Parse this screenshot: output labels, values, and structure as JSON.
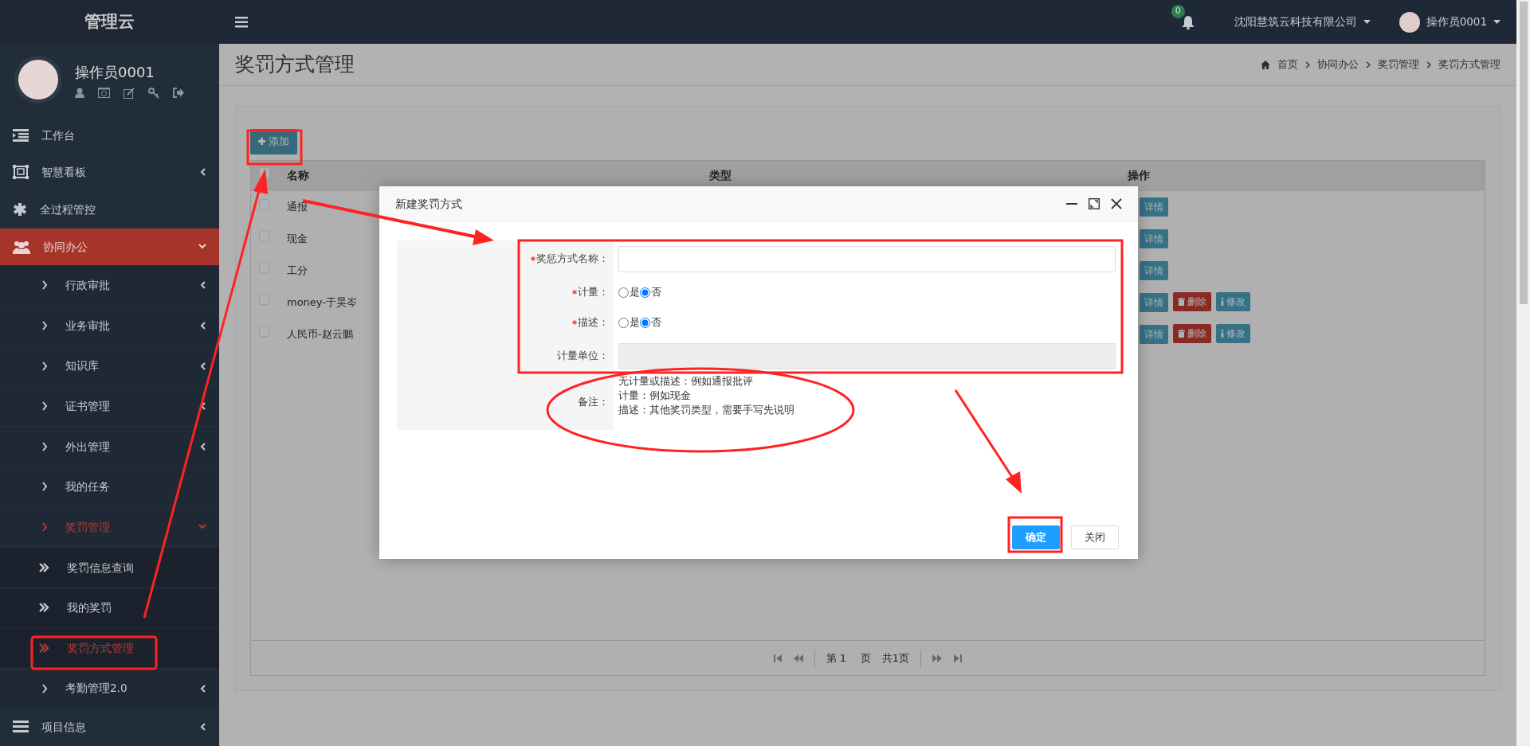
{
  "sidebar": {
    "brand": "管理云",
    "user": {
      "name": "操作员0001"
    },
    "menu": [
      {
        "label": "工作台",
        "selected": false
      },
      {
        "label": "智慧看板",
        "expanded": false,
        "selected": false
      },
      {
        "label": "全过程管控",
        "selected": false
      },
      {
        "label": "协同办公",
        "expanded": true,
        "children": [
          {
            "label": "行政审批",
            "expanded": false,
            "selected": false
          },
          {
            "label": "业务审批",
            "expanded": false,
            "selected": false
          },
          {
            "label": "知识库",
            "expanded": false,
            "selected": false
          },
          {
            "label": "证书管理",
            "expanded": false,
            "selected": false
          },
          {
            "label": "外出管理",
            "expanded": false,
            "selected": false
          },
          {
            "label": "我的任务",
            "selected": false
          },
          {
            "label": "奖罚管理",
            "expanded": true,
            "children": [
              {
                "label": "奖罚信息查询",
                "selected": false
              },
              {
                "label": "我的奖罚",
                "selected": false
              },
              {
                "label": "奖罚方式管理",
                "selected": true
              }
            ]
          },
          {
            "label": "考勤管理2.0",
            "expanded": false,
            "selected": false
          }
        ]
      },
      {
        "label": "项目信息",
        "expanded": false,
        "selected": false
      }
    ]
  },
  "header": {
    "notification_count": "0",
    "company": "沈阳慧筑云科技有限公司",
    "user": "操作员0001"
  },
  "page": {
    "title": "奖罚方式管理",
    "breadcrumb": [
      "首页",
      "协同办公",
      "奖罚管理",
      "奖罚方式管理"
    ]
  },
  "toolbar": {
    "add_button": "添加"
  },
  "table": {
    "select_all_checked": false,
    "columns": [
      "名称",
      "类型",
      "操作"
    ],
    "rows": [
      {
        "checked": false,
        "name": "通报",
        "actions": [
          {
            "kind": "detail",
            "label": "详情"
          }
        ]
      },
      {
        "checked": false,
        "name": "现金",
        "actions": [
          {
            "kind": "detail",
            "label": "详情"
          }
        ]
      },
      {
        "checked": false,
        "name": "工分",
        "actions": [
          {
            "kind": "detail",
            "label": "详情"
          }
        ]
      },
      {
        "checked": false,
        "name": "money-于昊岑",
        "actions": [
          {
            "kind": "detail",
            "label": "详情"
          },
          {
            "kind": "delete",
            "label": "删除"
          },
          {
            "kind": "edit",
            "label": "修改"
          }
        ]
      },
      {
        "checked": false,
        "name": "人民币-赵云鵬",
        "actions": [
          {
            "kind": "detail",
            "label": "详情"
          },
          {
            "kind": "delete",
            "label": "删除"
          },
          {
            "kind": "edit",
            "label": "修改"
          }
        ]
      }
    ]
  },
  "pagination": {
    "prefix": "第",
    "page": "1",
    "suffix": "页",
    "total": "共1页"
  },
  "dialog": {
    "title": "新建奖罚方式",
    "fields": [
      {
        "kind": "text",
        "label": "奖惩方式名称：",
        "required": true,
        "disabled": false
      },
      {
        "kind": "radio",
        "label": "计量：",
        "required": true,
        "options": [
          {
            "label": "是",
            "selected": false
          },
          {
            "label": "否",
            "selected": true
          }
        ]
      },
      {
        "kind": "radio",
        "label": "描述：",
        "required": true,
        "options": [
          {
            "label": "是",
            "selected": false
          },
          {
            "label": "否",
            "selected": true
          }
        ]
      },
      {
        "kind": "text",
        "label": "计量单位：",
        "required": false,
        "disabled": true
      },
      {
        "kind": "note",
        "label": "备注：",
        "required": false,
        "lines": [
          "无计量或描述：例如通报批评",
          "计量：例如现金",
          "描述：其他奖罚类型，需要手写先说明"
        ]
      }
    ],
    "buttons": [
      {
        "kind": "primary",
        "label": "确定"
      },
      {
        "kind": "default",
        "label": "关闭"
      }
    ]
  }
}
